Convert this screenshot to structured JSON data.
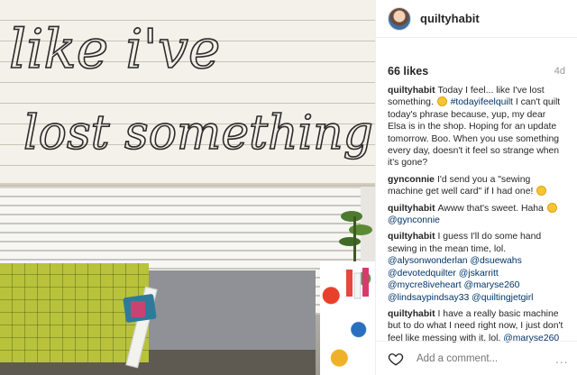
{
  "post": {
    "username": "quiltyhabit",
    "likes": "66 likes",
    "age": "4d",
    "photo_text": [
      "like i've",
      "lost something"
    ]
  },
  "comments": [
    {
      "user": "quiltyhabit",
      "parts": [
        {
          "t": "Today I feel... like I've lost something. "
        },
        {
          "emoji": "sad"
        },
        {
          "t": " "
        },
        {
          "tag": "#todayifeelquilt"
        },
        {
          "t": " I can't quilt today's phrase because, yup, my dear Elsa is in the shop. Hoping for an update tomorrow. Boo. When you use something every day, doesn't it feel so strange when it's gone?"
        }
      ]
    },
    {
      "user": "gynconnie",
      "parts": [
        {
          "t": "I'd send you a \"sewing machine get well card\" if I had one! "
        },
        {
          "emoji": "smile"
        }
      ]
    },
    {
      "user": "quiltyhabit",
      "parts": [
        {
          "t": "Awww that's sweet. Haha "
        },
        {
          "emoji": "smile"
        },
        {
          "t": " "
        },
        {
          "tag": "@gynconnie"
        }
      ]
    },
    {
      "user": "quiltyhabit",
      "parts": [
        {
          "t": "I guess I'll do some hand sewing in the mean time, lol. "
        },
        {
          "tag": "@alysonwonderlan"
        },
        {
          "t": " "
        },
        {
          "tag": "@dsuewahs"
        },
        {
          "t": " "
        },
        {
          "tag": "@devotedquilter"
        },
        {
          "t": " "
        },
        {
          "tag": "@jskarritt"
        },
        {
          "t": " "
        },
        {
          "tag": "@mycre8iveheart"
        },
        {
          "t": " "
        },
        {
          "tag": "@maryse260"
        },
        {
          "t": " "
        },
        {
          "tag": "@lindsaypindsay33"
        },
        {
          "t": " "
        },
        {
          "tag": "@quiltingjetgirl"
        }
      ]
    },
    {
      "user": "quiltyhabit",
      "parts": [
        {
          "t": "I have a really basic machine but to do what I need right now, I just don't feel like messing with it, lol. "
        },
        {
          "tag": "@maryse260"
        }
      ]
    }
  ],
  "footer": {
    "add_comment_placeholder": "Add a comment...",
    "more_label": "..."
  },
  "colors": {
    "tag": "#003569",
    "muted": "#999999",
    "border": "#efefef"
  }
}
